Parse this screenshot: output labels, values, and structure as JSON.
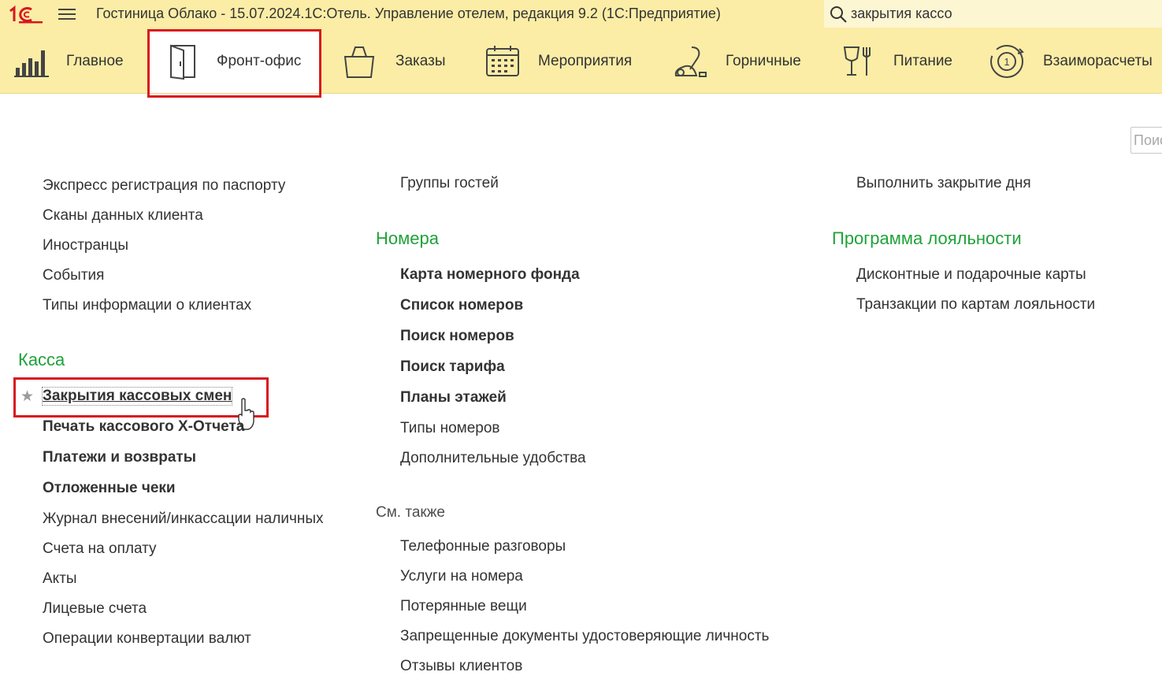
{
  "window": {
    "title": "Гостиница Облако - 15.07.2024.1С:Отель. Управление отелем, редакция 9.2  (1С:Предприятие)",
    "logo_text": "1С",
    "search_value": "закрытия кассо"
  },
  "sections": [
    {
      "label": "Главное",
      "icon": "bar-chart-icon"
    },
    {
      "label": "Фронт-офис",
      "icon": "door-icon",
      "active": true
    },
    {
      "label": "Заказы",
      "icon": "shopping-bag-icon"
    },
    {
      "label": "Мероприятия",
      "icon": "calendar-icon"
    },
    {
      "label": "Горничные",
      "icon": "vacuum-cleaner-icon"
    },
    {
      "label": "Питание",
      "icon": "glass-fork-icon"
    },
    {
      "label": "Взаиморасчеты",
      "icon": "coin-cycle-icon"
    }
  ],
  "panel_search": {
    "placeholder": "Поиск"
  },
  "column1": {
    "items": [
      "Экспресс регистрация по паспорту",
      "Сканы данных клиента",
      "Иностранцы",
      "События",
      "Типы информации о клиентах"
    ],
    "kassa": {
      "title": "Касса",
      "items": [
        "Закрытия кассовых смен",
        "Печать кассового X-Отчета",
        "Платежи и возвраты",
        "Отложенные чеки",
        "Журнал внесений/инкассации наличных",
        "Счета на оплату",
        "Акты",
        "Лицевые счета",
        "Операции конвертации валют"
      ]
    }
  },
  "column2": {
    "items": [
      "Группы гостей"
    ],
    "rooms": {
      "title": "Номера",
      "items": [
        "Карта номерного фонда",
        "Список номеров",
        "Поиск номеров",
        "Поиск тарифа",
        "Планы этажей",
        "Типы номеров",
        "Дополнительные удобства"
      ]
    },
    "see_also": {
      "title": "См. также",
      "items": [
        "Телефонные разговоры",
        "Услуги на номера",
        "Потерянные вещи",
        "Запрещенные документы удостоверяющие личность",
        "Отзывы клиентов"
      ]
    }
  },
  "column3": {
    "items": [
      "Выполнить закрытие дня"
    ],
    "loyalty": {
      "title": "Программа лояльности",
      "items": [
        "Дисконтные и подарочные карты",
        "Транзакции по картам лояльности"
      ]
    }
  },
  "colors": {
    "accent": "#fbeda6",
    "group_title": "#1fa23a",
    "highlight": "#d8171f"
  }
}
